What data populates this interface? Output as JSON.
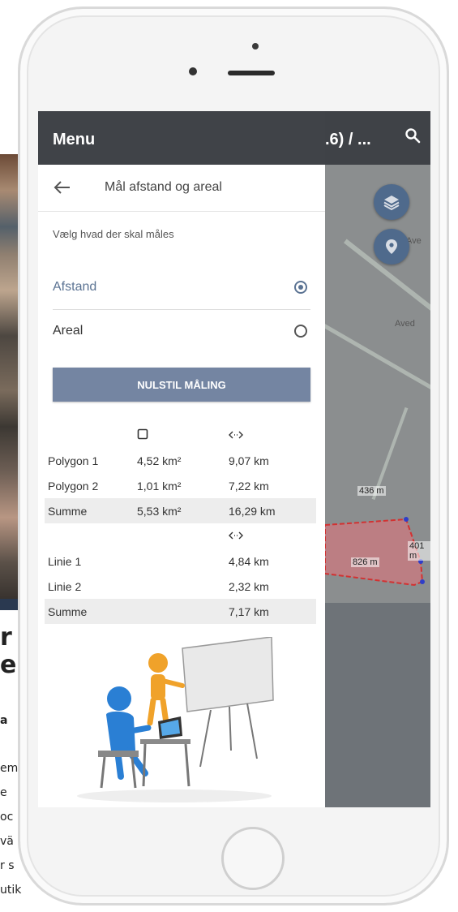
{
  "background_page": {
    "heading_line1": "r",
    "heading_line2": "e",
    "subheading": "a",
    "text_lines": [
      "em",
      "e",
      "oc",
      "vä",
      "r s",
      "utik"
    ]
  },
  "map": {
    "title_fragment": ".6) / ...",
    "labels": [
      "Ave",
      "Aved"
    ],
    "measurements": [
      "436 m",
      "401 m",
      "826 m"
    ],
    "colors": {
      "polygon_stroke": "#d23232",
      "polygon_fill": "#c87a80",
      "vertex": "#2f3ec8"
    }
  },
  "drawer": {
    "title": "Menu",
    "nav_title": "Mål afstand og areal",
    "prompt": "Vælg hvad der skal måles",
    "options": [
      {
        "label": "Afstand",
        "selected": true
      },
      {
        "label": "Areal",
        "selected": false
      }
    ],
    "reset_label": "NULSTIL MÅLING",
    "accent": "#5b7393",
    "button_color": "#7485a2"
  },
  "polygon_table": {
    "icons": [
      "square-area-icon",
      "distance-arrows-icon"
    ],
    "rows": [
      {
        "name": "Polygon 1",
        "area": "4,52 km²",
        "length": "9,07 km"
      },
      {
        "name": "Polygon 2",
        "area": "1,01 km²",
        "length": "7,22 km"
      },
      {
        "name": "Summe",
        "area": "5,53 km²",
        "length": "16,29 km"
      }
    ]
  },
  "line_table": {
    "icons": [
      "distance-arrows-icon"
    ],
    "rows": [
      {
        "name": "Linie 1",
        "length": "4,84 km"
      },
      {
        "name": "Linie 2",
        "length": "2,32 km"
      },
      {
        "name": "Summe",
        "length": "7,17 km"
      }
    ]
  }
}
